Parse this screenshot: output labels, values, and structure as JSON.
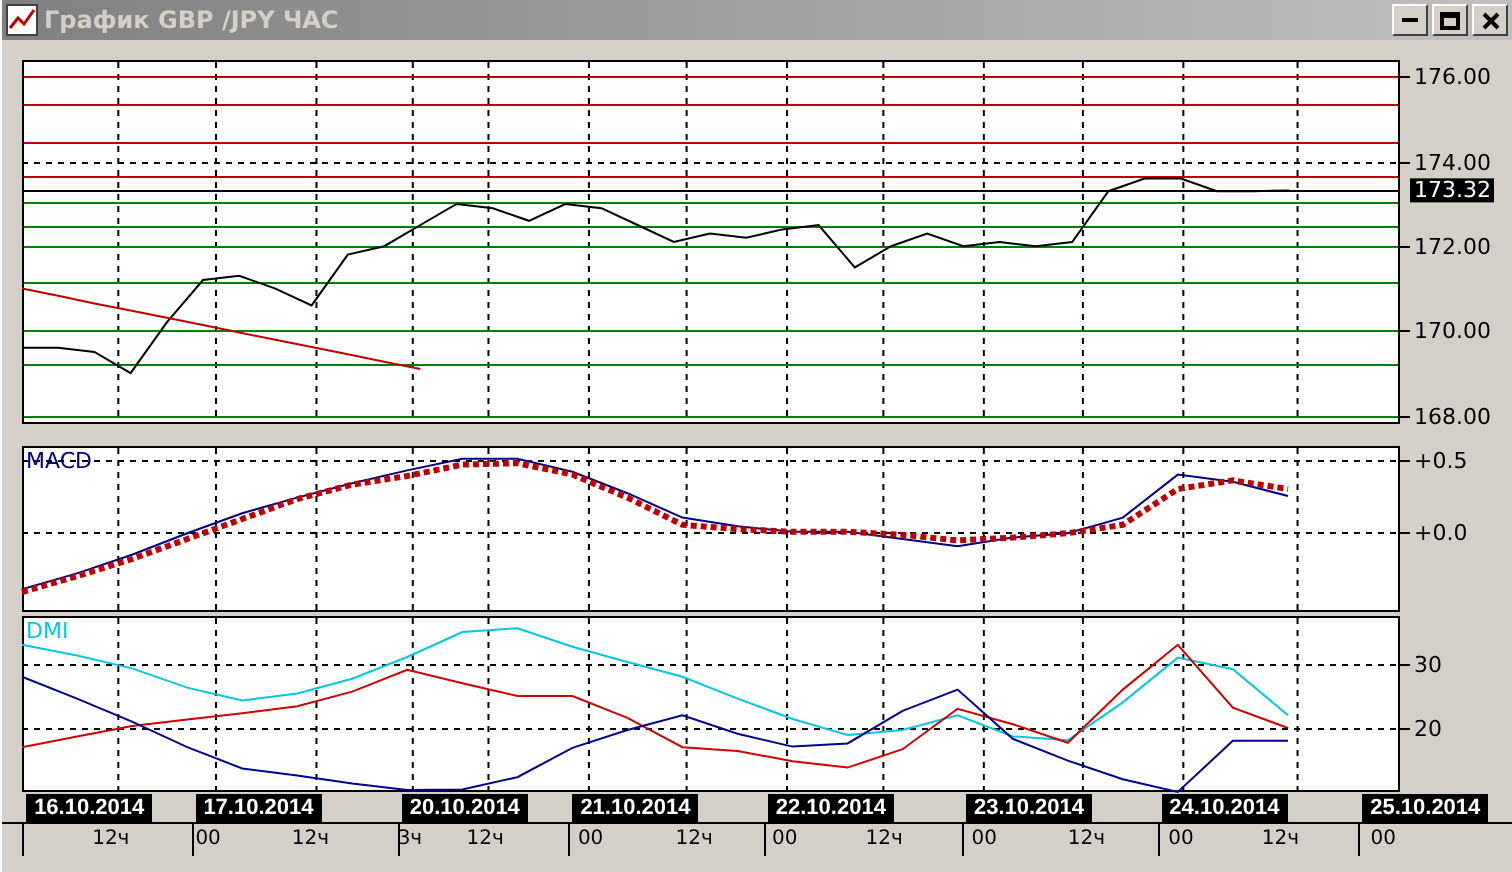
{
  "window": {
    "title": "График GBP /JPY  ЧАС"
  },
  "price_chart": {
    "current_price": "173.32",
    "chart_data": {
      "type": "line",
      "ylim": [
        167.8,
        176.4
      ],
      "yticks": [
        {
          "value": 168,
          "label": "168.00"
        },
        {
          "value": 170,
          "label": "170.00"
        },
        {
          "value": 172,
          "label": "172.00"
        },
        {
          "value": 174,
          "label": "174.00"
        },
        {
          "value": 176,
          "label": "176.00"
        }
      ],
      "categories": [
        null,
        null,
        null,
        null,
        null,
        null,
        null,
        null,
        null,
        null,
        null,
        null,
        null,
        null,
        null,
        null,
        null,
        null,
        null,
        null,
        null,
        null,
        null,
        null,
        null,
        null,
        null,
        null,
        null,
        null,
        null,
        null,
        null,
        null,
        null,
        null,
        null,
        null,
        null
      ],
      "series": [
        {
          "color": "#000000",
          "values": [
            169.6,
            169.6,
            169.5,
            169.0,
            170.2,
            171.2,
            171.3,
            171.0,
            170.6,
            171.8,
            172.0,
            172.5,
            173.0,
            172.9,
            172.6,
            173.0,
            172.9,
            172.5,
            172.1,
            172.3,
            172.2,
            172.4,
            172.5,
            171.5,
            172.0,
            172.3,
            172.0,
            172.1,
            172.0,
            172.1,
            173.3,
            173.6,
            173.6,
            173.3,
            173.3,
            173.32,
            null,
            null,
            null
          ]
        },
        {
          "color": "#c00000",
          "values": [
            171.0,
            170.83,
            170.65,
            170.48,
            170.31,
            170.14,
            169.96,
            169.79,
            169.62,
            169.45,
            169.27,
            169.1,
            null,
            null,
            null,
            null,
            null,
            null,
            null,
            null,
            null,
            null,
            null,
            null,
            null,
            null,
            null,
            null,
            null,
            null,
            null,
            null,
            null,
            null,
            null,
            null,
            null,
            null,
            null
          ]
        }
      ],
      "grid": true,
      "ref_lines": [
        {
          "axis": "y",
          "value": 176.0,
          "color": "#c00000"
        },
        {
          "axis": "y",
          "value": 175.35,
          "color": "#c00000"
        },
        {
          "axis": "y",
          "value": 174.45,
          "color": "#c00000"
        },
        {
          "axis": "y",
          "value": 173.65,
          "color": "#c00000"
        },
        {
          "axis": "y",
          "value": 173.32,
          "color": "#000000"
        },
        {
          "axis": "y",
          "value": 173.05,
          "color": "#008000"
        },
        {
          "axis": "y",
          "value": 172.5,
          "color": "#008000"
        },
        {
          "axis": "y",
          "value": 172.0,
          "color": "#008000"
        },
        {
          "axis": "y",
          "value": 171.15,
          "color": "#008000"
        },
        {
          "axis": "y",
          "value": 170.0,
          "color": "#008000"
        },
        {
          "axis": "y",
          "value": 169.2,
          "color": "#008000"
        },
        {
          "axis": "y",
          "value": 168.0,
          "color": "#008000"
        }
      ]
    }
  },
  "macd_chart": {
    "chart_data": {
      "type": "line",
      "title": "MACD",
      "ylim": [
        -0.56,
        0.6
      ],
      "grid": true,
      "yticks": [
        {
          "value": 0,
          "label": "+0.0"
        },
        {
          "value": 0.5,
          "label": "+0.5"
        }
      ],
      "categories": [
        null,
        null,
        null,
        null,
        null,
        null,
        null,
        null,
        null,
        null,
        null,
        null,
        null,
        null,
        null,
        null,
        null,
        null,
        null,
        null,
        null,
        null,
        null,
        null,
        null,
        null
      ],
      "series": [
        {
          "color": "#000080",
          "values": [
            -0.4,
            -0.29,
            -0.16,
            -0.01,
            0.13,
            0.24,
            0.34,
            0.43,
            0.51,
            0.51,
            0.42,
            0.27,
            0.1,
            0.04,
            0.0,
            0.0,
            -0.05,
            -0.1,
            -0.04,
            -0.01,
            0.1,
            0.4,
            0.35,
            0.25,
            null,
            null
          ]
        },
        {
          "color": "#c00000",
          "line_style": "dotted",
          "values": [
            -0.42,
            -0.31,
            -0.19,
            -0.05,
            0.09,
            0.23,
            0.33,
            0.39,
            0.47,
            0.48,
            0.4,
            0.24,
            0.05,
            0.02,
            0.0,
            0.0,
            -0.02,
            -0.06,
            -0.04,
            -0.01,
            0.05,
            0.3,
            0.36,
            0.3,
            null,
            null
          ]
        }
      ]
    }
  },
  "dmi_chart": {
    "chart_data": {
      "type": "line",
      "title": "DMI",
      "ylim": [
        10,
        37.5
      ],
      "grid": true,
      "yticks": [
        {
          "value": 20,
          "label": "20"
        },
        {
          "value": 30,
          "label": "30"
        }
      ],
      "categories": [
        null,
        null,
        null,
        null,
        null,
        null,
        null,
        null,
        null,
        null,
        null,
        null,
        null,
        null,
        null,
        null,
        null,
        null,
        null,
        null,
        null,
        null,
        null,
        null,
        null,
        null
      ],
      "series": [
        {
          "color": "#00c8e0",
          "values": [
            33,
            31.3,
            29.3,
            26.3,
            24.3,
            25.4,
            27.7,
            31.1,
            35,
            35.6,
            32.7,
            30.3,
            28,
            24.6,
            21.4,
            18.9,
            19.7,
            22,
            18.7,
            18.1,
            24,
            31,
            29.2,
            22,
            null,
            null
          ]
        },
        {
          "color": "#d00000",
          "values": [
            17,
            18.7,
            20.3,
            21.3,
            22.3,
            23.4,
            25.7,
            29.1,
            27,
            25,
            25,
            21.6,
            17,
            16.4,
            14.8,
            13.8,
            16.7,
            23,
            20.6,
            17.7,
            26,
            33,
            23.2,
            20,
            null,
            null
          ]
        },
        {
          "color": "#000090",
          "values": [
            28,
            24.6,
            21,
            17,
            13.7,
            12.6,
            11.3,
            10.3,
            10.4,
            12.3,
            16.9,
            19.7,
            22,
            19.1,
            17.1,
            17.6,
            22.7,
            26,
            18.3,
            14.9,
            12,
            10,
            18,
            18,
            null,
            null
          ]
        }
      ]
    }
  },
  "time_axis": {
    "dates": [
      "16.10.2014",
      "17.10.2014",
      "20.10.2014",
      "21.10.2014",
      "22.10.2014",
      "23.10.2014",
      "24.10.2014",
      "25.10.2014"
    ],
    "hours": [
      "12ч",
      "00",
      "12ч",
      "3ч",
      "12ч",
      "00",
      "12ч",
      "00",
      "12ч",
      "00",
      "12ч",
      "00",
      "12ч",
      "00"
    ]
  }
}
